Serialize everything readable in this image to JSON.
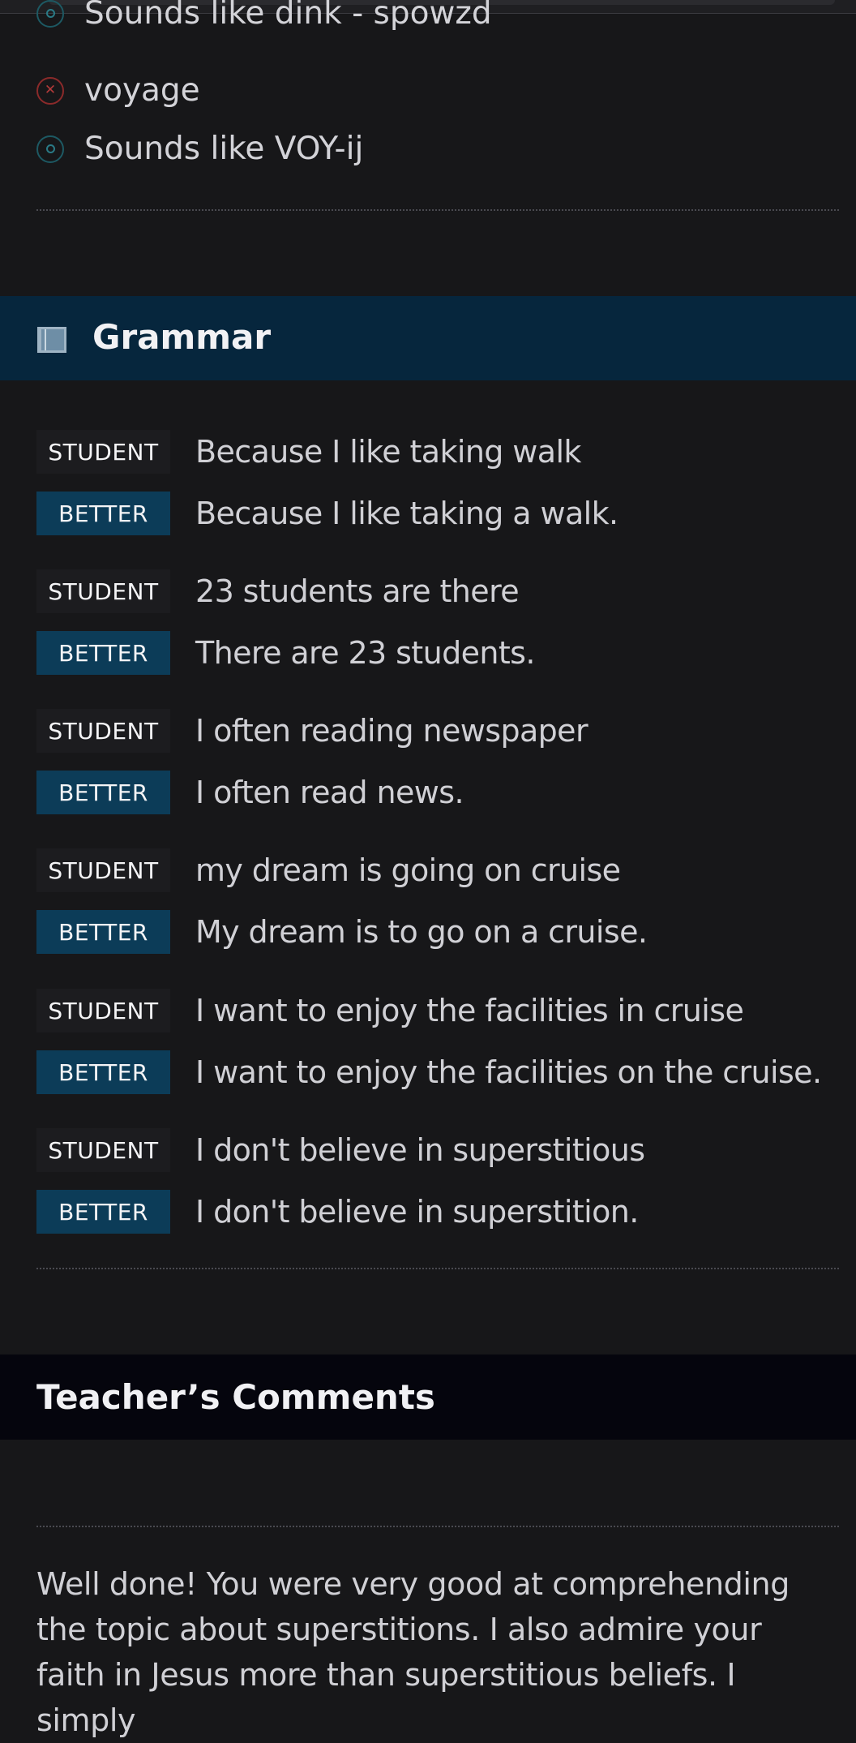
{
  "pronunciation": {
    "items": [
      {
        "kind": "target",
        "icon": "target-icon",
        "text": "Sounds like dink - spowzd"
      },
      {
        "kind": "wrong",
        "icon": "x-circle-icon",
        "text": "voyage"
      },
      {
        "kind": "target",
        "icon": "target-icon",
        "text": "Sounds like VOY-ij"
      }
    ]
  },
  "grammar": {
    "title": "Grammar",
    "icon": "book-icon",
    "student_label": "STUDENT",
    "better_label": "BETTER",
    "pairs": [
      {
        "student": "Because I like taking walk",
        "better": "Because I like taking a walk."
      },
      {
        "student": "23 students are there",
        "better": "There are 23 students."
      },
      {
        "student": "I often reading newspaper",
        "better": "I often read news."
      },
      {
        "student": "my dream is going on cruise",
        "better": "My dream is to go on a cruise."
      },
      {
        "student": "I want to enjoy the facilities in cruise",
        "better": "I want to enjoy the facilities on the cruise."
      },
      {
        "student": "I don't believe in superstitious",
        "better": "I don't believe in superstition."
      }
    ]
  },
  "comments": {
    "title": "Teacher’s Comments",
    "body": "Well done! You were very good at comprehending the topic about superstitions. I also admire your faith in Jesus more than superstitious beliefs. I simply"
  },
  "colors": {
    "background": "#171719",
    "grammar_header": "#06263d",
    "comments_header": "#05050d",
    "better_tag": "#0c3c58",
    "wrong_icon": "#b23a3a",
    "target_icon": "#2a7a86"
  }
}
